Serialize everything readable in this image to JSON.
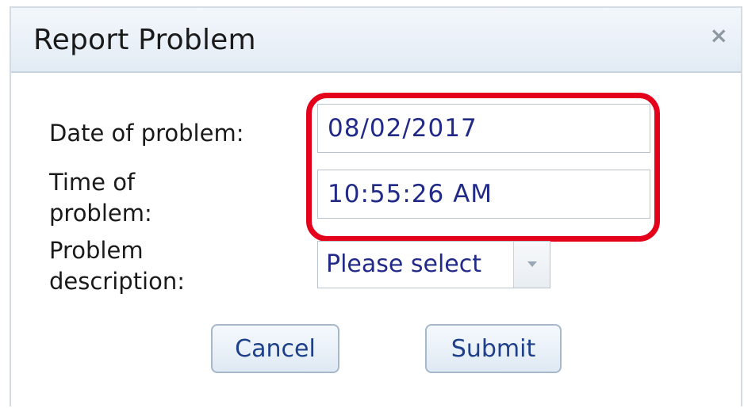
{
  "dialog": {
    "title": "Report Problem",
    "close_label": "×"
  },
  "form": {
    "date_label": "Date of problem:",
    "date_value": "08/02/2017",
    "time_label_line1": "Time of",
    "time_label_line2": "problem:",
    "time_value": "10:55:26 AM",
    "desc_label_line1": "Problem",
    "desc_label_line2": "description:",
    "desc_selected": "Please select"
  },
  "buttons": {
    "cancel_label": "Cancel",
    "submit_label": "Submit"
  },
  "colors": {
    "highlight": "#e4001b",
    "value_text": "#222a88",
    "button_text": "#1e3f8a"
  },
  "icons": {
    "close": "close-icon",
    "dropdown": "chevron-down-icon"
  }
}
